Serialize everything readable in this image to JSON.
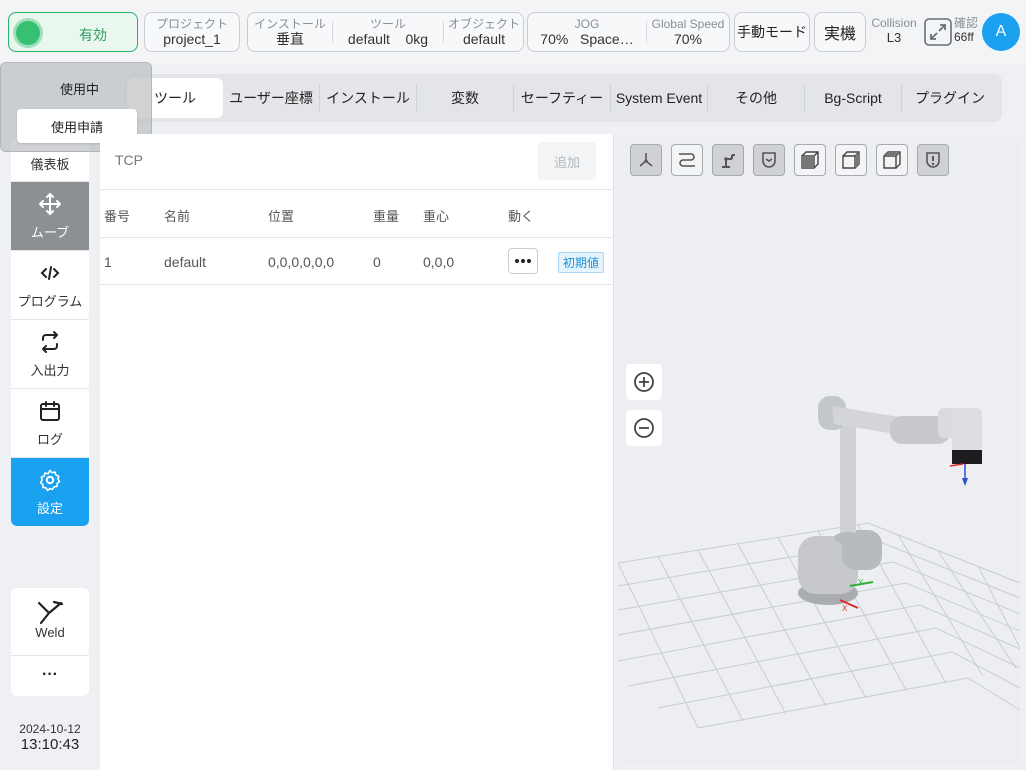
{
  "topbar": {
    "enable_label": "有効",
    "project": {
      "label": "プロジェクト",
      "value": "project_1"
    },
    "install": {
      "label": "インストール",
      "value": "垂直"
    },
    "tool": {
      "label": "ツール",
      "value": "default",
      "weight": "0kg"
    },
    "object": {
      "label": "オブジェクト",
      "value": "default"
    },
    "jog": {
      "label": "JOG",
      "percent": "70%",
      "mode": "Space…"
    },
    "global_speed": {
      "label": "Global Speed",
      "value": "70%"
    },
    "manual_mode": "手動モード",
    "real_machine": "実機",
    "collision": {
      "label": "Collision",
      "value": "L3"
    },
    "confirm": {
      "label": "確認",
      "value": "66ff"
    },
    "avatar_letter": "A"
  },
  "usage": {
    "status": "使用中",
    "request": "使用申請"
  },
  "sidebar": {
    "items": [
      {
        "label": "儀表板"
      },
      {
        "label": "ムーブ"
      },
      {
        "label": "プログラム"
      },
      {
        "label": "入出力"
      },
      {
        "label": "ログ"
      },
      {
        "label": "設定"
      }
    ],
    "weld": "Weld",
    "more": "···",
    "date": "2024-10-12",
    "time": "13:10:43"
  },
  "tabs": [
    "ツール",
    "ユーザー座標",
    "インストール",
    "変数",
    "セーフティー",
    "System Event",
    "その他",
    "Bg-Script",
    "プラグイン"
  ],
  "tool_panel": {
    "section": "TCP",
    "add_button": "追加",
    "columns": [
      "番号",
      "名前",
      "位置",
      "重量",
      "重心",
      "動く"
    ],
    "rows": [
      {
        "no": "1",
        "name": "default",
        "position": "0,0,0,0,0,0",
        "weight": "0",
        "cog": "0,0,0",
        "badge": "初期値"
      }
    ]
  },
  "viewer": {
    "axis_labels": {
      "x": "X",
      "y": "Y"
    },
    "buttons": [
      "axes-view-icon",
      "path-icon",
      "robot-icon",
      "shield-check-icon",
      "cube-front-icon",
      "cube-side-icon",
      "cube-top-icon",
      "shield-alert-icon"
    ]
  },
  "colors": {
    "accent": "#1aa1f0",
    "enabled_green": "#36c071",
    "badge_blue": "#1a8fd8"
  }
}
